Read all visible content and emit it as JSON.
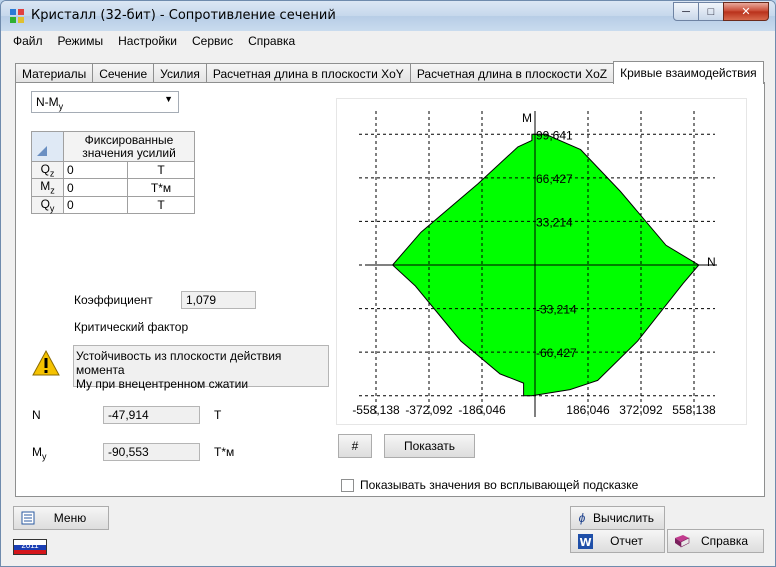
{
  "window": {
    "title": "Кристалл (32-бит) - Сопротивление сечений"
  },
  "menu": [
    "Файл",
    "Режимы",
    "Настройки",
    "Сервис",
    "Справка"
  ],
  "tabs": [
    "Материалы",
    "Сечение",
    "Усилия",
    "Расчетная длина в плоскости XoY",
    "Расчетная длина в плоскости XoZ",
    "Кривые взаимодействия"
  ],
  "active_tab": "Кривые взаимодействия",
  "curve_select": {
    "value": "N-M",
    "sub": "y"
  },
  "forces_table": {
    "header_line1": "Фиксированные",
    "header_line2": "значения усилий",
    "rows": [
      {
        "name": "Q",
        "sub": "z",
        "value": "0",
        "unit": "Т"
      },
      {
        "name": "M",
        "sub": "z",
        "value": "0",
        "unit": "Т*м"
      },
      {
        "name": "Q",
        "sub": "y",
        "value": "0",
        "unit": "Т"
      }
    ]
  },
  "coefficient": {
    "label": "Коэффициент",
    "value": "1,079"
  },
  "critical_factor": {
    "label": "Критический фактор",
    "text_line1": "Устойчивость из плоскости действия момента",
    "text_line2": "My при внецентренном сжатии"
  },
  "results": {
    "n_label": "N",
    "n_value": "-47,914",
    "n_unit": "Т",
    "m_label": "M",
    "m_sub": "y",
    "m_value": "-90,553",
    "m_unit": "Т*м"
  },
  "chart_data": {
    "type": "area",
    "xlabel": "N",
    "ylabel": "M",
    "xlim": [
      -651.161,
      651.161
    ],
    "ylim": [
      -116.241,
      116.241
    ],
    "x_ticks": [
      "-558,138",
      "-372,092",
      "-186,046",
      "186,046",
      "372,092",
      "558,138"
    ],
    "y_ticks": [
      "99,641",
      "66,427",
      "33,214",
      "-33,214",
      "-66,427"
    ],
    "grid": true,
    "fill_color": "#00ff00",
    "curve": [
      {
        "x": -11,
        "y": 99.6
      },
      {
        "x": 37,
        "y": 99.6
      },
      {
        "x": 160,
        "y": 88
      },
      {
        "x": 300,
        "y": 56
      },
      {
        "x": 460,
        "y": 15
      },
      {
        "x": 575,
        "y": 0
      },
      {
        "x": 520,
        "y": -14
      },
      {
        "x": 360,
        "y": -58
      },
      {
        "x": 220,
        "y": -88
      },
      {
        "x": 123,
        "y": -95
      },
      {
        "x": -11,
        "y": -99.6
      },
      {
        "x": -40,
        "y": -99.6
      },
      {
        "x": -40,
        "y": -90
      },
      {
        "x": -123,
        "y": -83
      },
      {
        "x": -260,
        "y": -58
      },
      {
        "x": -420,
        "y": -16
      },
      {
        "x": -500,
        "y": 0
      },
      {
        "x": -400,
        "y": 25
      },
      {
        "x": -200,
        "y": 62
      },
      {
        "x": -60,
        "y": 90
      },
      {
        "x": -11,
        "y": 95
      }
    ]
  },
  "buttons": {
    "hash": "#",
    "show": "Показать",
    "menu": "Меню",
    "calculate": "Вычислить",
    "report": "Отчет",
    "help": "Справка"
  },
  "tooltip_checkbox": "Показывать значения во всплывающей подсказке",
  "year_badge": "2011"
}
